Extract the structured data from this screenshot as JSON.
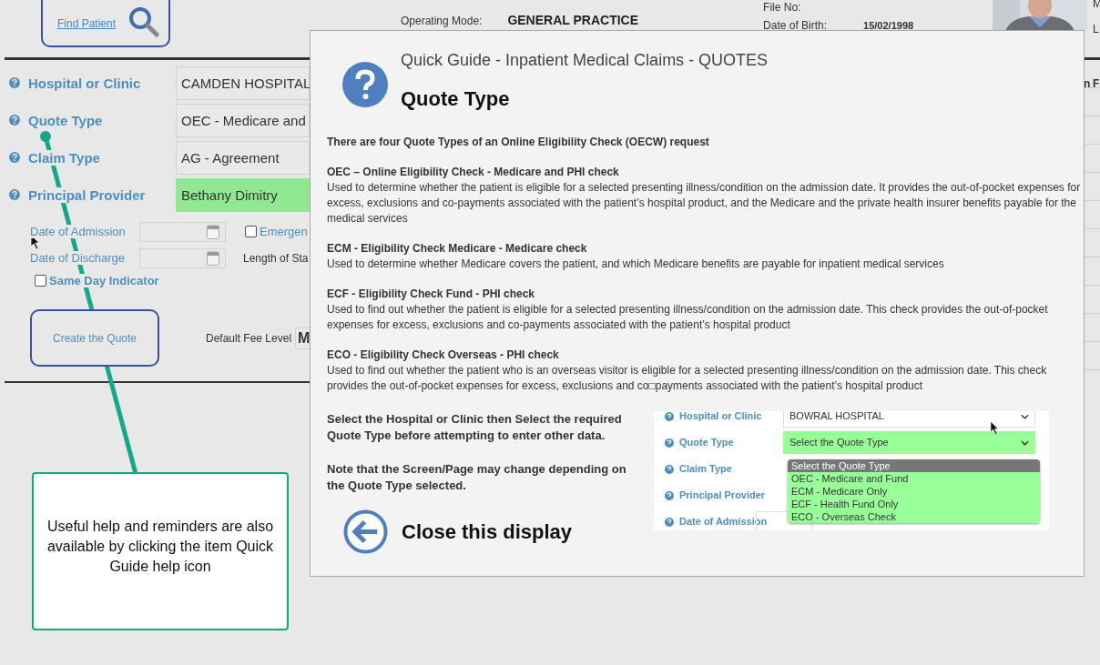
{
  "top_bar": {
    "find_patient": "Find Patient",
    "operating_mode_label": "Operating Mode:",
    "operating_mode": "GENERAL PRACTICE",
    "file_no_label": "File No:",
    "dob_label": "Date of Birth:",
    "dob": "15/02/1998",
    "edge_texts": [
      "M",
      "L"
    ]
  },
  "form": {
    "rows": [
      {
        "label": "Hospital or Clinic",
        "value": "CAMDEN HOSPITAL",
        "highlighted": false
      },
      {
        "label": "Quote Type",
        "value": "OEC - Medicare and",
        "highlighted": false
      },
      {
        "label": "Claim Type",
        "value": "AG - Agreement",
        "highlighted": false
      },
      {
        "label": "Principal Provider",
        "value": "Bethany Dimitry",
        "highlighted": true
      }
    ],
    "dates": [
      {
        "label": "Date of Admission"
      },
      {
        "label": "Date of Discharge"
      }
    ],
    "emergency": {
      "label": "Emergen",
      "checked": false
    },
    "length_of_stay_label": "Length of Sta",
    "same_day": {
      "label": "Same Day Indicator",
      "checked": false
    },
    "create_button": "Create the Quote",
    "default_fee_label": "Default Fee Level",
    "default_fee_value": "M"
  },
  "table_header": "n F",
  "quick_guide": {
    "title": "Quick Guide - Inpatient Medical Claims - QUOTES",
    "heading": "Quote Type",
    "intro": "There are four Quote Types of an Online Eligibility Check (OECW) request",
    "sections": [
      {
        "title": "OEC – Online Eligibility Check - Medicare and PHI check",
        "text": "Used to determine whether the patient is eligible for a selected presenting illness/condition on the admission date. It provides the out-of-pocket expenses for excess, exclusions and co-payments associated with the patient’s hospital product, and the Medicare and the private health insurer benefits payable for the medical services"
      },
      {
        "title": "ECM - Eligibility Check Medicare - Medicare check",
        "text": "Used to determine whether Medicare covers the patient, and which Medicare benefits are payable for inpatient medical services"
      },
      {
        "title": "ECF - Eligibility Check Fund - PHI check",
        "text": "Used to find out whether the patient is eligible for a selected presenting illness/condition on the admission date. This check provides the out-of-pocket expenses for excess, exclusions and co-payments associated with the patient’s hospital product"
      },
      {
        "title": "ECO - Eligibility Check Overseas - PHI check",
        "text": "Used to find out whether the patient who is an overseas visitor is eligible for a selected presenting illness/condition on the admission date. This check provides the out-of-pocket expenses for excess, exclusions and co□payments associated with the patient’s hospital product"
      }
    ],
    "instructions": [
      "Select the Hospital or Clinic then Select the required Quote Type before attempting to enter other data.",
      "Note that the Screen/Page may change depending on the Quote Type selected."
    ],
    "close": "Close this display",
    "example": {
      "rows": [
        {
          "label": "Hospital or Clinic",
          "kind": "select",
          "value": "BOWRAL HOSPITAL",
          "highlighted": false
        },
        {
          "label": "Quote Type",
          "kind": "select",
          "value": "Select the Quote Type",
          "highlighted": true
        },
        {
          "label": "Claim Type",
          "kind": "none"
        },
        {
          "label": "Principal Provider",
          "kind": "none"
        },
        {
          "label": "Date of Admission",
          "kind": "date"
        }
      ],
      "dropdown": [
        {
          "label": "Select the Quote Type",
          "selected": true
        },
        {
          "label": "OEC - Medicare and Fund",
          "selected": false
        },
        {
          "label": "ECM - Medicare Only",
          "selected": false
        },
        {
          "label": "ECF - Health Fund Only",
          "selected": false
        },
        {
          "label": "ECO - Overseas Check",
          "selected": false
        }
      ]
    }
  },
  "callout": {
    "text": "Useful help and reminders are also available by clicking the item Quick Guide help icon"
  }
}
